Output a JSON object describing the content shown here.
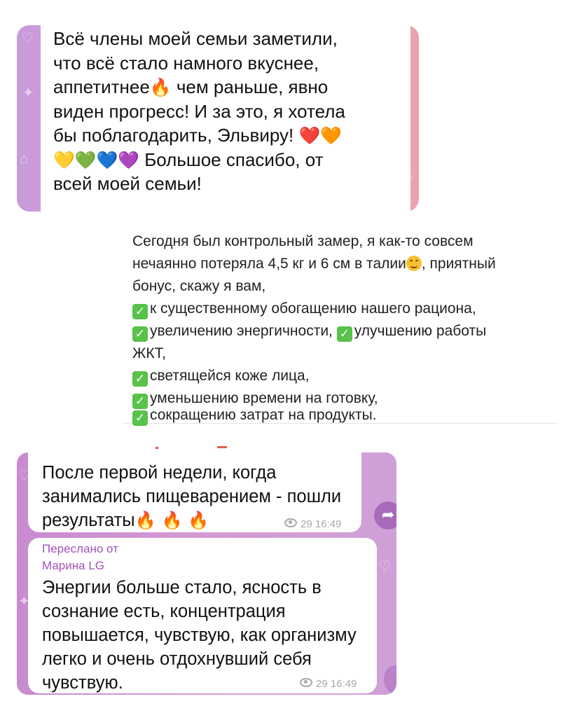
{
  "block1": {
    "lines": [
      "Всё члены моей семьи заметили,",
      "что всё стало намного вкуснее,",
      "аппетитнее",
      " чем раньше, явно",
      "виден прогресс! И за это, я хотела",
      "бы поблагодарить, Эльвиру! ",
      " Большое спасибо, от",
      "всей моей семьи!"
    ],
    "emoji_fire": "🔥",
    "emoji_hearts_1": "❤️🧡",
    "emoji_hearts_2": "💛💚💙💜"
  },
  "block2": {
    "intro_1": "Сегодня был контрольный замер, я как-то совсем",
    "intro_2a": "нечаянно потеряла 4,5 кг и 6 см в талии",
    "intro_2b": ", приятный",
    "intro_3": "бонус, скажу я вам,",
    "check_icon": "✓",
    "items": [
      "к существенному обогащению нашего рациона,",
      "увеличению энергичности, ",
      "улучшению работы",
      "ЖКТ,",
      "светящейся коже лица,",
      "уменьшению времени на готовку,",
      "сокращению затрат на продукты."
    ]
  },
  "block3": {
    "msg1": {
      "lines": [
        "После первой недели, когда",
        "занимались пищеварением - пошли",
        "результаты"
      ],
      "emoji": "🔥 🔥 🔥",
      "views": "29",
      "time": "16:49"
    },
    "share_icon": "➦",
    "msg2": {
      "forwarded_label": "Переслано от",
      "forwarded_from": "Марина LG",
      "lines": [
        "Энергии больше стало, ясность в",
        "сознание есть, концентрация",
        "повышается, чувствую, как организму",
        "легко и очень отдохнувший себя",
        "чувствую."
      ],
      "views": "29",
      "time": "16:49"
    }
  },
  "colors": {
    "bg_purple": "#c98bd0",
    "bg_pink": "#eaa3ae",
    "forward_purple": "#a152b8",
    "check_green": "#58c24a",
    "meta_gray": "#a8a8a8"
  }
}
